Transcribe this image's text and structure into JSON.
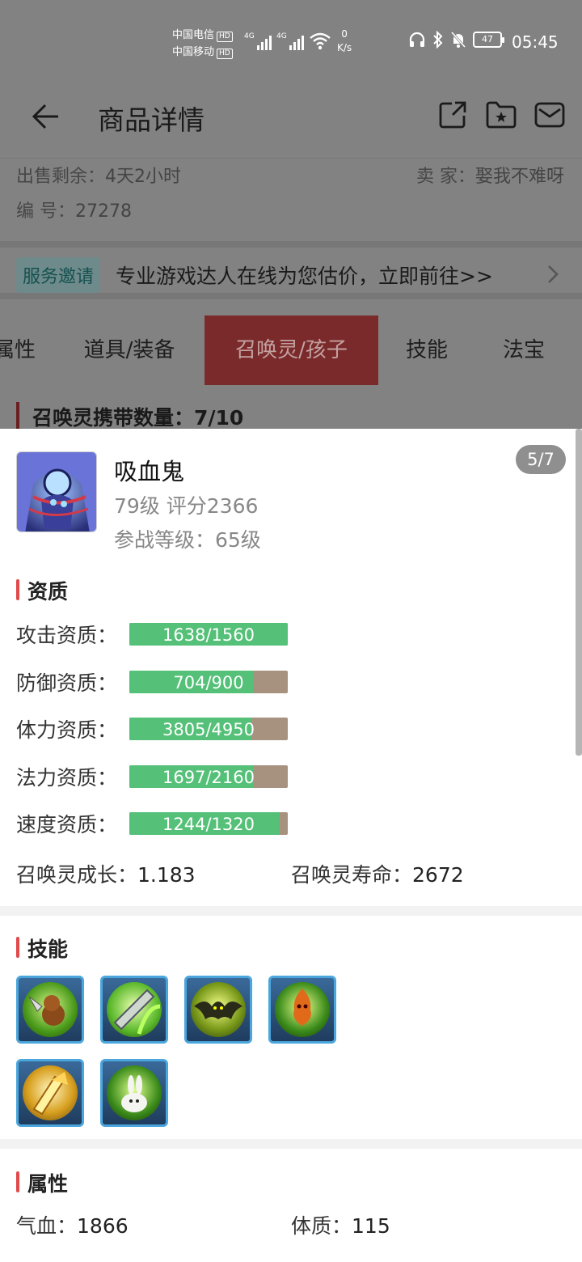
{
  "status_bar": {
    "carrier1": "中国电信",
    "carrier2": "中国移动",
    "hd": "HD",
    "network1": "4G",
    "network2": "4G",
    "speed_value": "0",
    "speed_unit": "K/s",
    "battery": "47",
    "time": "05:45"
  },
  "header": {
    "title": "商品详情",
    "icons": [
      "back-icon",
      "share-icon",
      "favorite-folder-icon",
      "message-icon"
    ]
  },
  "meta": {
    "remaining_label": "出售剩余：",
    "remaining_value": "4天2小时",
    "seller_label": "卖  家：",
    "seller_value": "娶我不难呀",
    "id_label": "编  号：",
    "id_value": "27278"
  },
  "service": {
    "badge": "服务邀请",
    "text": "专业游戏达人在线为您估价，立即前往>>"
  },
  "tabs": [
    {
      "label": "属性"
    },
    {
      "label": "道具/装备"
    },
    {
      "label": "召唤灵/孩子",
      "active": true
    },
    {
      "label": "技能"
    },
    {
      "label": "法宝"
    }
  ],
  "summon_count": "召唤灵携带数量：7/10",
  "pet": {
    "name": "吸血鬼",
    "level_score": "79级 评分2366",
    "battle_level": "参战等级：65级",
    "pager": "5/7"
  },
  "aptitude": {
    "title": "资质",
    "rows": [
      {
        "label": "攻击资质：",
        "value": "1638/1560",
        "current": 1638,
        "max": 1560
      },
      {
        "label": "防御资质：",
        "value": "704/900",
        "current": 704,
        "max": 900
      },
      {
        "label": "体力资质：",
        "value": "3805/4950",
        "current": 3805,
        "max": 4950
      },
      {
        "label": "法力资质：",
        "value": "1697/2160",
        "current": 1697,
        "max": 2160
      },
      {
        "label": "速度资质：",
        "value": "1244/1320",
        "current": 1244,
        "max": 1320
      }
    ],
    "growth_label": "召唤灵成长：",
    "growth_value": "1.183",
    "life_label": "召唤灵寿命：",
    "life_value": "2672"
  },
  "skills": {
    "title": "技能",
    "icons": [
      "skill-monkey-axe-icon",
      "skill-green-blade-icon",
      "skill-bat-icon",
      "skill-fire-spirit-icon",
      "skill-golden-wing-icon",
      "skill-white-rabbit-icon"
    ]
  },
  "attributes": {
    "title": "属性",
    "rows": [
      {
        "label": "气血：",
        "value": "1866"
      },
      {
        "label": "体质：",
        "value": "115"
      }
    ]
  },
  "colors": {
    "accent_red": "#e14a4a",
    "bar_green": "#55c078",
    "bar_brown": "#a7917f",
    "skill_border": "#4aa6dd"
  }
}
